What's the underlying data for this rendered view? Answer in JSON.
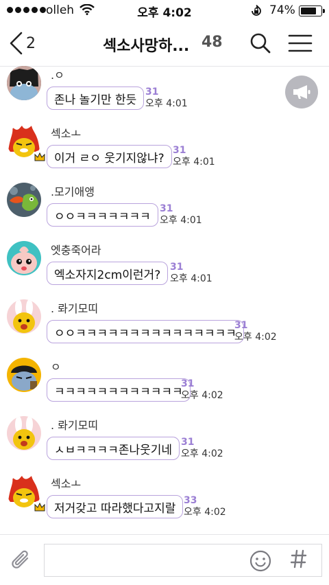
{
  "status_bar": {
    "carrier": "olleh",
    "time": "오후 4:02",
    "battery": "74%"
  },
  "header": {
    "back_count": "2",
    "title": "섹소사망하...",
    "member_count": "48"
  },
  "messages": [
    {
      "sender": ".ㅇ",
      "text": "존나 놀기만 한듯",
      "unread": "31",
      "time": "오후 4:01",
      "avatar": "ryan-avatar",
      "crown": false
    },
    {
      "sender": "섹소ㅗ",
      "text": "이거 ㄹㅇ 웃기지않냐?",
      "unread": "31",
      "time": "오후 4:01",
      "avatar": "fire-avatar",
      "crown": true
    },
    {
      "sender": ".모기애앵",
      "text": "ㅇㅇㅋㅋㅋㅋㅋㅋㅋ",
      "unread": "31",
      "time": "오후 4:01",
      "avatar": "dragon-avatar",
      "crown": false
    },
    {
      "sender": "엣충죽어라",
      "text": "엑소자지2cm이런거?",
      "unread": "31",
      "time": "오후 4:01",
      "avatar": "apeach-avatar",
      "crown": false
    },
    {
      "sender": ". 롸기모띠",
      "text": "ㅇㅇㅋㅋㅋㅋㅋㅋㅋㅋㅋㅋㅋㅋㅋㅋㅋ",
      "unread": "31",
      "time": "오후 4:02",
      "avatar": "muzi-avatar",
      "crown": false
    },
    {
      "sender": "ㅇ",
      "text": "ㅋㅋㅋㅋㅋㅋㅋㅋㅋㅋㅋㅋ",
      "unread": "31",
      "time": "오후 4:02",
      "avatar": "frodo-avatar",
      "crown": false
    },
    {
      "sender": ". 롸기모띠",
      "text": "ㅅㅂㅋㅋㅋㅋ존나웃기네",
      "unread": "31",
      "time": "오후 4:02",
      "avatar": "muzi-avatar",
      "crown": false
    },
    {
      "sender": "섹소ㅗ",
      "text": "저거갖고 따라했다고지랄",
      "unread": "33",
      "time": "오후 4:02",
      "avatar": "fire-avatar",
      "crown": true
    }
  ],
  "input": {
    "placeholder": ""
  },
  "colors": {
    "bubble_border": "#b9a3dd",
    "unread": "#9b7fd4",
    "notice_button": "#b8b8be"
  }
}
